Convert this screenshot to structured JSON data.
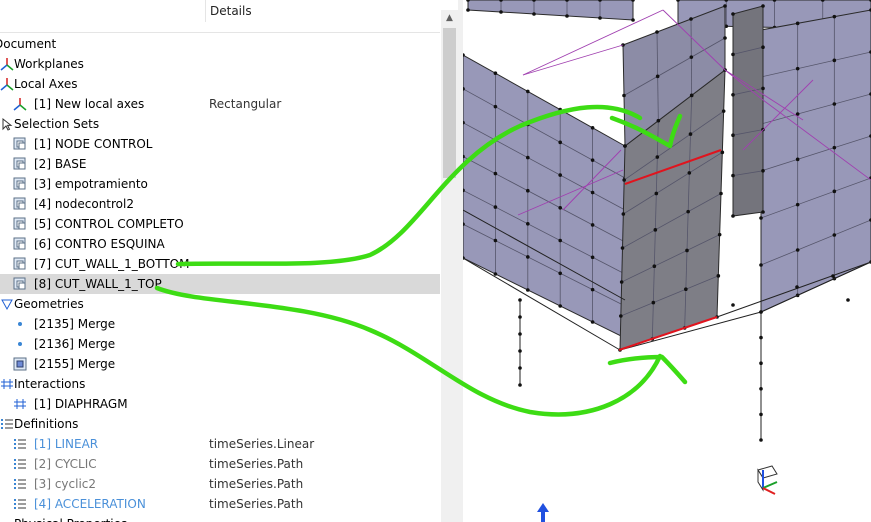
{
  "tree": {
    "details_header": "Details",
    "items": [
      {
        "label": "Document",
        "detail": "",
        "icon": "document-icon",
        "indent": 0,
        "style": ""
      },
      {
        "label": "Workplanes",
        "detail": "",
        "icon": "workplane-icon",
        "indent": 1,
        "style": ""
      },
      {
        "label": "Local Axes",
        "detail": "",
        "icon": "local-axes-icon",
        "indent": 1,
        "style": ""
      },
      {
        "label": "[1] New local axes",
        "detail": "Rectangular",
        "icon": "axes-icon",
        "indent": 2,
        "style": ""
      },
      {
        "label": "Selection Sets",
        "detail": "",
        "icon": "selection-sets-icon",
        "indent": 1,
        "style": ""
      },
      {
        "label": "[1] NODE CONTROL",
        "detail": "",
        "icon": "selection-set-icon",
        "indent": 2,
        "style": ""
      },
      {
        "label": "[2] BASE",
        "detail": "",
        "icon": "selection-set-icon",
        "indent": 2,
        "style": ""
      },
      {
        "label": "[3] empotramiento",
        "detail": "",
        "icon": "selection-set-icon",
        "indent": 2,
        "style": ""
      },
      {
        "label": "[4] nodecontrol2",
        "detail": "",
        "icon": "selection-set-icon",
        "indent": 2,
        "style": ""
      },
      {
        "label": "[5] CONTROL COMPLETO",
        "detail": "",
        "icon": "selection-set-icon",
        "indent": 2,
        "style": ""
      },
      {
        "label": "[6] CONTRO ESQUINA",
        "detail": "",
        "icon": "selection-set-icon",
        "indent": 2,
        "style": ""
      },
      {
        "label": "[7] CUT_WALL_1_BOTTOM",
        "detail": "",
        "icon": "selection-set-icon",
        "indent": 2,
        "style": ""
      },
      {
        "label": "[8] CUT_WALL_1_TOP",
        "detail": "",
        "icon": "selection-set-icon",
        "indent": 2,
        "style": "selected"
      },
      {
        "label": "Geometries",
        "detail": "",
        "icon": "geometries-icon",
        "indent": 1,
        "style": ""
      },
      {
        "label": "[2135] Merge",
        "detail": "",
        "icon": "point-icon",
        "indent": 2,
        "style": ""
      },
      {
        "label": "[2136] Merge",
        "detail": "",
        "icon": "point-icon",
        "indent": 2,
        "style": ""
      },
      {
        "label": "[2155] Merge",
        "detail": "",
        "icon": "mesh-icon",
        "indent": 2,
        "style": ""
      },
      {
        "label": "Interactions",
        "detail": "",
        "icon": "interactions-icon",
        "indent": 1,
        "style": ""
      },
      {
        "label": "[1] DIAPHRAGM",
        "detail": "",
        "icon": "diaphragm-icon",
        "indent": 2,
        "style": ""
      },
      {
        "label": "Definitions",
        "detail": "",
        "icon": "definitions-icon",
        "indent": 1,
        "style": ""
      },
      {
        "label": "[1] LINEAR",
        "detail": "timeSeries.Linear",
        "icon": "list-icon",
        "indent": 2,
        "style": "blue"
      },
      {
        "label": "[2] CYCLIC",
        "detail": "timeSeries.Path",
        "icon": "list-icon",
        "indent": 2,
        "style": "gray"
      },
      {
        "label": "[3] cyclic2",
        "detail": "timeSeries.Path",
        "icon": "list-icon",
        "indent": 2,
        "style": "gray"
      },
      {
        "label": "[4] ACCELERATION",
        "detail": "timeSeries.Path",
        "icon": "list-icon",
        "indent": 2,
        "style": "blue"
      },
      {
        "label": "Physical Properties",
        "detail": "",
        "icon": "properties-icon",
        "indent": 1,
        "style": ""
      }
    ]
  },
  "colors": {
    "selection": "#d9d9d9",
    "accent_blue": "#4a90d9",
    "wall_face": "#9898b8",
    "wall_dark": "#74747c",
    "annotation_green": "#3ddc14",
    "highlight_red": "#e0141e",
    "diaphragm_purple": "#a040b0"
  }
}
